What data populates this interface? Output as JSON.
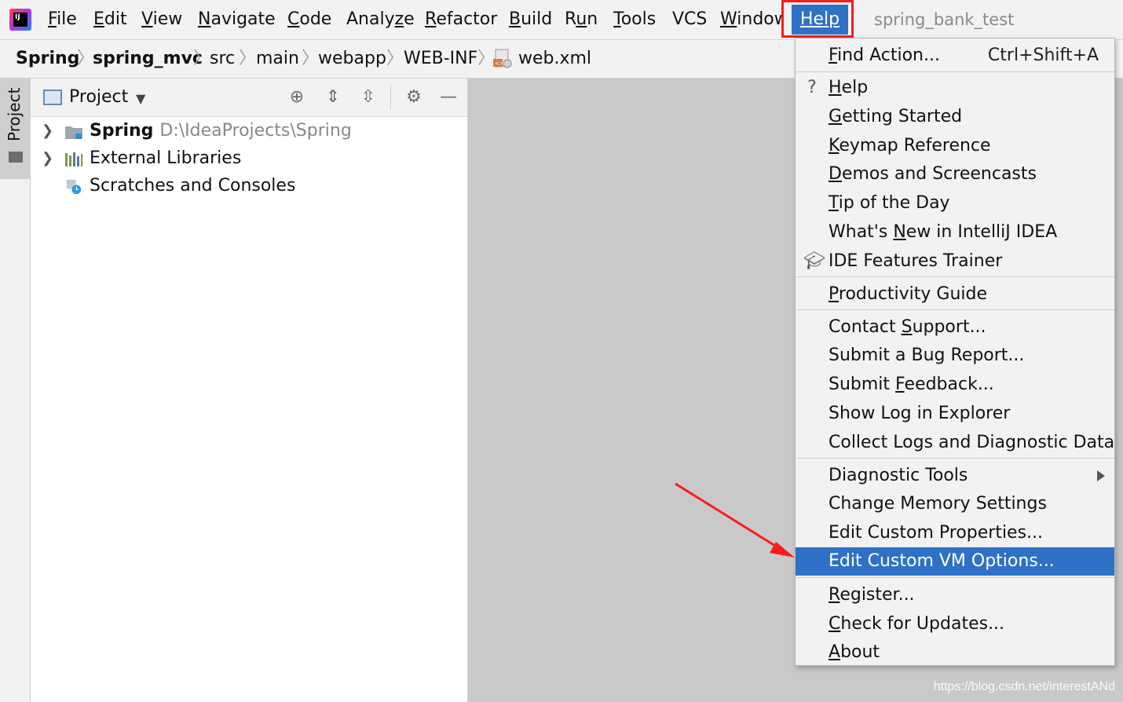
{
  "menubar": {
    "items": [
      {
        "label": "File",
        "ul": "F",
        "rest": "ile"
      },
      {
        "label": "Edit",
        "ul": "E",
        "rest": "dit"
      },
      {
        "label": "View",
        "ul": "V",
        "rest": "iew"
      },
      {
        "label": "Navigate",
        "ul": "N",
        "rest": "avigate"
      },
      {
        "label": "Code",
        "ul": "C",
        "rest": "ode"
      },
      {
        "label": "Analyze",
        "ul": "",
        "rest": "Analyze"
      },
      {
        "label": "Refactor",
        "ul": "R",
        "rest": "efactor"
      },
      {
        "label": "Build",
        "ul": "B",
        "rest": "uild"
      },
      {
        "label": "Run",
        "ul": "",
        "rest": "Run"
      },
      {
        "label": "Tools",
        "ul": "T",
        "rest": "ools"
      },
      {
        "label": "VCS",
        "ul": "",
        "rest": "VCS"
      },
      {
        "label": "Window",
        "ul": "",
        "rest": "Windov"
      }
    ],
    "help": "Help",
    "window_title": "spring_bank_test"
  },
  "breadcrumb": {
    "items": [
      "Spring",
      "spring_mvc",
      "src",
      "main",
      "webapp",
      "WEB-INF",
      "web.xml"
    ]
  },
  "tool_stripe": {
    "project_tab": "Project"
  },
  "project_panel": {
    "title": "Project",
    "tree": [
      {
        "label": "Spring",
        "path": "D:\\IdeaProjects\\Spring"
      },
      {
        "label": "External Libraries"
      },
      {
        "label": "Scratches and Consoles"
      }
    ]
  },
  "help_menu": {
    "find_action": {
      "label": "Find Action...",
      "shortcut": "Ctrl+Shift+A"
    },
    "items": [
      {
        "label": "Help"
      },
      {
        "label": "Getting Started"
      },
      {
        "label": "Keymap Reference"
      },
      {
        "label": "Demos and Screencasts"
      },
      {
        "label": "Tip of the Day"
      },
      {
        "label": "What's New in IntelliJ IDEA"
      },
      {
        "label": "IDE Features Trainer"
      },
      {
        "label": "Productivity Guide"
      },
      {
        "label": "Contact Support..."
      },
      {
        "label": "Submit a Bug Report..."
      },
      {
        "label": "Submit Feedback..."
      },
      {
        "label": "Show Log in Explorer"
      },
      {
        "label": "Collect Logs and Diagnostic Data"
      },
      {
        "label": "Diagnostic Tools"
      },
      {
        "label": "Change Memory Settings"
      },
      {
        "label": "Edit Custom Properties..."
      },
      {
        "label": "Edit Custom VM Options..."
      },
      {
        "label": "Register..."
      },
      {
        "label": "Check for Updates..."
      },
      {
        "label": "About"
      }
    ]
  },
  "watermark": "https://blog.csdn.net/interestANd",
  "colors": {
    "selection": "#2f71c6",
    "highlight_box": "#ff1a1a",
    "arrow": "#ff1a1a"
  }
}
